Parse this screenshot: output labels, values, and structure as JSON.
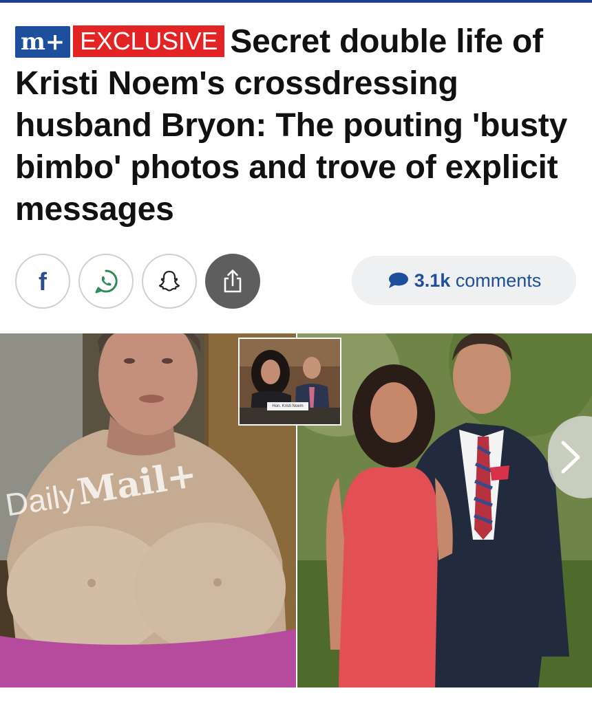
{
  "headline": {
    "mplus_badge": "m+",
    "exclusive_badge": "EXCLUSIVE",
    "text": "Secret double life of Kristi Noem's crossdressing husband Bryon: The pouting 'busty bimbo' photos and trove of explicit messages"
  },
  "share": {
    "buttons": [
      {
        "name": "facebook",
        "icon": "facebook-icon"
      },
      {
        "name": "whatsapp",
        "icon": "whatsapp-icon"
      },
      {
        "name": "snapchat",
        "icon": "snapchat-icon"
      },
      {
        "name": "share",
        "icon": "share-icon"
      }
    ]
  },
  "comments": {
    "count": "3.1k",
    "label": "comments",
    "icon": "speech-bubble-icon"
  },
  "photo": {
    "watermark_daily": "Daily",
    "watermark_mail": "Mail+",
    "inset_caption": "Hon. Kristi Noem",
    "next_icon": "chevron-right-icon"
  },
  "colors": {
    "brand_blue": "#1e4f9c",
    "exclusive_red": "#e32424",
    "top_stripe": "#1f3e8f"
  }
}
